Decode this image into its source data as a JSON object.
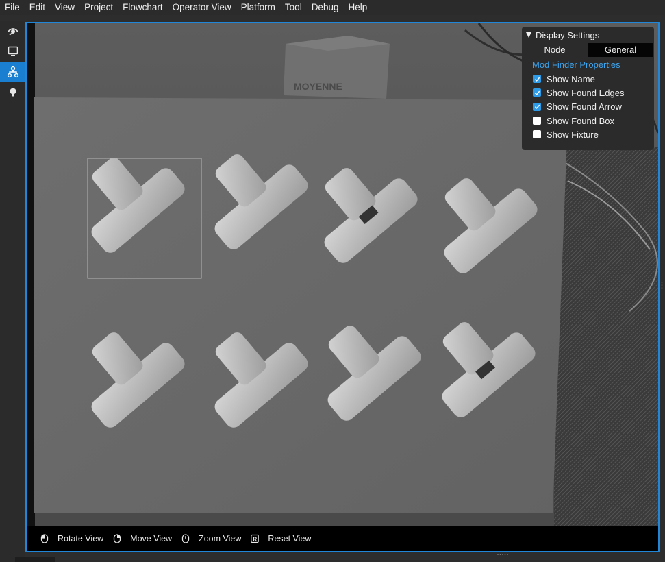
{
  "menu": [
    "File",
    "Edit",
    "View",
    "Project",
    "Flowchart",
    "Operator View",
    "Platform",
    "Tool",
    "Debug",
    "Help"
  ],
  "rail": {
    "items": [
      {
        "icon": "eye-icon",
        "active": false
      },
      {
        "icon": "monitor-icon",
        "active": false
      },
      {
        "icon": "flowchart-icon",
        "active": true
      },
      {
        "icon": "lightbulb-icon",
        "active": false
      }
    ]
  },
  "scene": {
    "box_label": "MOYENNE"
  },
  "display_settings": {
    "title": "Display Settings",
    "tabs": [
      "Node",
      "General"
    ],
    "selected_tab": "General",
    "section_title": "Mod Finder Properties",
    "options": [
      {
        "label": "Show Name",
        "checked": true
      },
      {
        "label": "Show Found Edges",
        "checked": true
      },
      {
        "label": "Show Found Arrow",
        "checked": true
      },
      {
        "label": "Show Found Box",
        "checked": false
      },
      {
        "label": "Show Fixture",
        "checked": false
      }
    ]
  },
  "viewbar": {
    "rotate": "Rotate View",
    "move": "Move View",
    "zoom": "Zoom View",
    "reset": "Reset View",
    "reset_key": "R"
  },
  "colors": {
    "accent": "#1f86d8",
    "checkbox_on": "#2e9be8",
    "section_title": "#3ea6f0"
  }
}
